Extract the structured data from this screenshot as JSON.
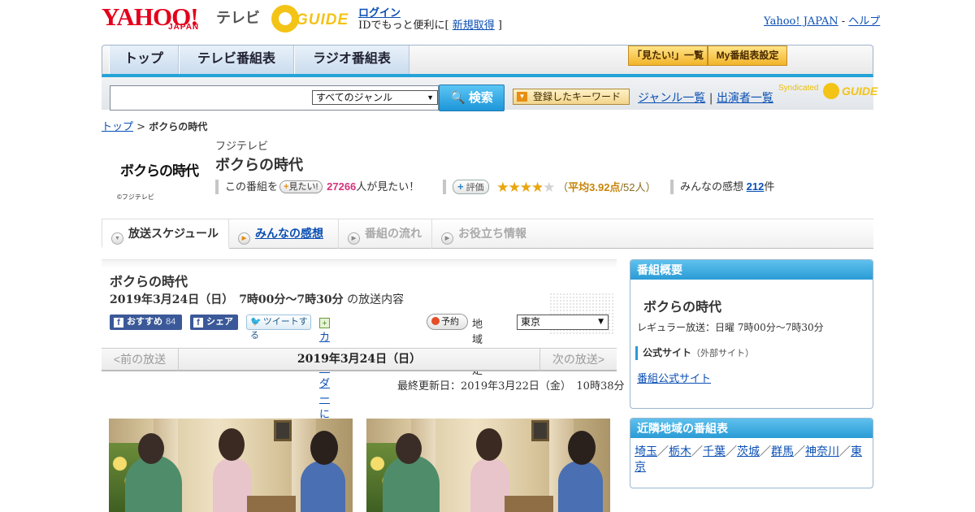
{
  "header": {
    "logo_yahoo": "YAHOO!",
    "logo_japan": "JAPAN",
    "logo_tv": "テレビ",
    "gguide_text": "GUIDE",
    "login": "ログイン",
    "login_message_prefix": "IDでもっと便利に[ ",
    "register": "新規取得",
    "login_message_suffix": " ]",
    "yahoo_japan_link": "Yahoo! JAPAN",
    "separator": " - ",
    "help_link": "ヘルプ"
  },
  "nav": {
    "tabs": [
      "トップ",
      "テレビ番組表",
      "ラジオ番組表"
    ],
    "mitai_list": "「見たい!」一覧",
    "my_schedule": "My番組表設定"
  },
  "search": {
    "input_value": "",
    "genre_selected": "すべてのジャンル",
    "search_button": "検索",
    "keyword_button": "登録したキーワード",
    "genre_list": "ジャンル一覧",
    "divider": "|",
    "performer_list": "出演者一覧",
    "syndicated": "Syndicated",
    "syndicated_guide": "GUIDE"
  },
  "breadcrumb": {
    "top": "トップ",
    "sep": " > ",
    "current": "ボクらの時代"
  },
  "program": {
    "logo_text": "ボクらの時代",
    "copyright": "©フジテレビ",
    "station": "フジテレビ",
    "title": "ボクらの時代",
    "mitai_prefix": "この番組を",
    "mitai_button": "見たい!",
    "mitai_count": "27266",
    "mitai_suffix": "人が見たい！",
    "eval_button": "評価",
    "rating_value": 3.92,
    "rating_stars": "★★★★★",
    "rating_open": "（",
    "rating_avg": "平均3.92点",
    "rating_count": "/52人）",
    "impressions_label": "みんなの感想",
    "impressions_count": "212",
    "impressions_unit": "件"
  },
  "tabs": [
    {
      "label": "放送スケジュール",
      "icon": "▼"
    },
    {
      "label": "みんなの感想",
      "icon": "▶"
    },
    {
      "label": "番組の流れ",
      "icon": "▶"
    },
    {
      "label": "お役立ち情報",
      "icon": "▶"
    }
  ],
  "broadcast": {
    "title": "ボクらの時代",
    "datetime": "2019年3月24日（日）　7時00分～7時30分",
    "datetime_suffix": "の放送内容",
    "fb_recommend": "おすすめ",
    "fb_count": "84",
    "fb_share": "シェア",
    "tweet": "ツイートする",
    "calendar": "カレンダーに登録",
    "reserve": "予約",
    "region_label": "地域設定",
    "region_selected": "東京"
  },
  "pager": {
    "prev": "<前の放送",
    "current": "2019年3月24日（日）",
    "next": "次の放送>"
  },
  "last_updated": "最終更新日：2019年3月22日（金）　10時38分",
  "sidebar": {
    "overview_header": "番組概要",
    "overview_title": "ボクらの時代",
    "regular": "レギュラー放送：日曜 7時00分～7時30分",
    "official_label": "公式サイト",
    "official_note": "（外部サイト）",
    "official_link": "番組公式サイト",
    "nearby_header": "近隣地域の番組表",
    "regions": [
      "埼玉",
      "栃木",
      "千葉",
      "茨城",
      "群馬",
      "神奈川",
      "東京"
    ],
    "region_sep": "／"
  },
  "colors": {
    "accent_blue": "#23a3d8",
    "link": "#0a4fb4",
    "star": "#eba60b",
    "mitai_pink": "#d6337c",
    "facebook": "#3b5998"
  }
}
